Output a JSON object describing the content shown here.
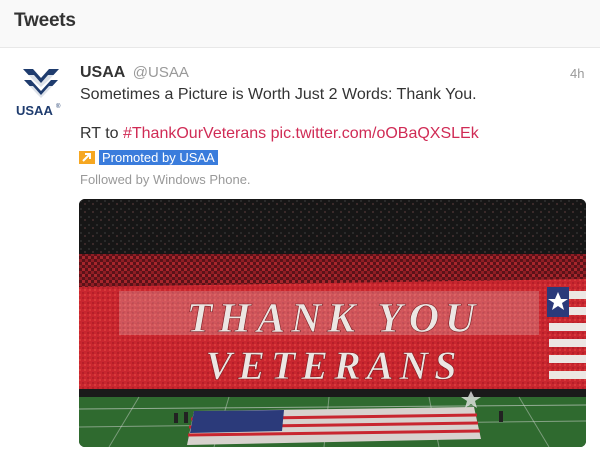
{
  "header": {
    "title": "Tweets"
  },
  "tweet": {
    "author_name": "USAA",
    "author_handle": "@USAA",
    "time": "4h",
    "text_line1": "Sometimes a Picture is Worth Just 2 Words: Thank You.",
    "text_prefix": "RT to ",
    "hashtag": "#ThankOurVeterans",
    "pic_link": "pic.twitter.com/oOBaQXSLEk",
    "promoted_label": "Promoted by USAA",
    "followed_by": "Followed by Windows Phone."
  },
  "avatar": {
    "logo_text": "USAA",
    "registered": "®",
    "brand_color": "#1f3c6e"
  },
  "photo": {
    "line1": "THANK YOU",
    "line2": "VETERANS",
    "card_red": "#c8262f",
    "card_white": "#e9e3df",
    "field_green": "#2f6a2f"
  },
  "icons": {
    "promoted": "promoted-arrow-icon"
  },
  "colors": {
    "link": "#d02b55",
    "promoted_bg": "#3a7cdc",
    "promoted_icon": "#f6a721"
  }
}
